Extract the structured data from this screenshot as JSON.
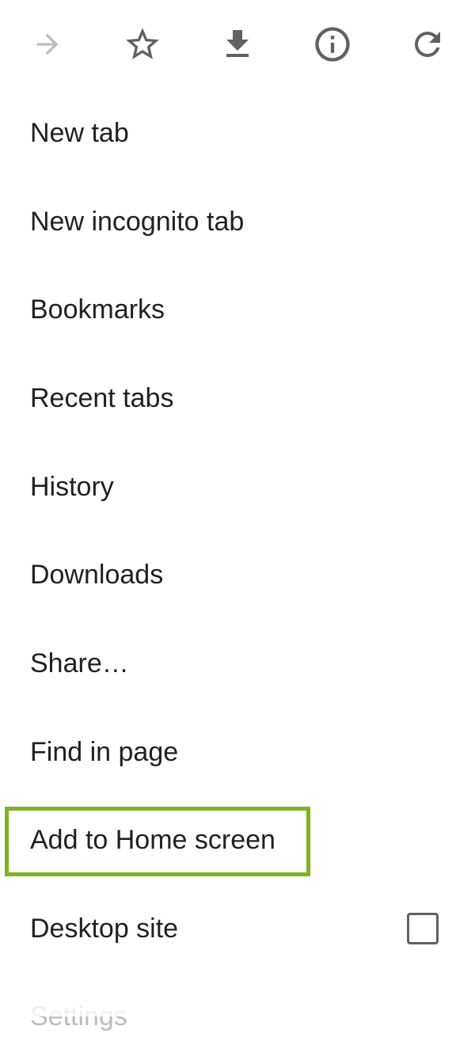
{
  "toolbar": {
    "icons": [
      "forward-icon",
      "star-icon",
      "download-icon",
      "info-icon",
      "refresh-icon"
    ],
    "forward_disabled": true
  },
  "menu": {
    "items": [
      {
        "label": "New tab"
      },
      {
        "label": "New incognito tab"
      },
      {
        "label": "Bookmarks"
      },
      {
        "label": "Recent tabs"
      },
      {
        "label": "History"
      },
      {
        "label": "Downloads"
      },
      {
        "label": "Share…"
      },
      {
        "label": "Find in page"
      },
      {
        "label": "Add to Home screen",
        "highlighted": true
      },
      {
        "label": "Desktop site",
        "checkbox": true,
        "checked": false
      },
      {
        "label": "Settings"
      }
    ]
  },
  "colors": {
    "text": "#212121",
    "icon": "#616161",
    "icon_disabled": "#bdbdbd",
    "highlight_border": "#7cb51f"
  }
}
